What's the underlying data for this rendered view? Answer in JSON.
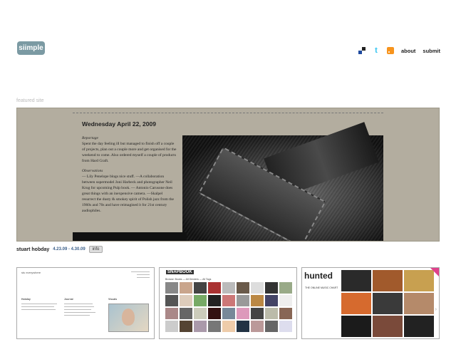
{
  "header": {
    "logo_text": "siimple",
    "nav": {
      "about": "about",
      "submit": "submit"
    },
    "icons": [
      "delicious-icon",
      "twitter-icon",
      "rss-icon"
    ]
  },
  "featured": {
    "label": "featured site",
    "post_date": "Wednesday April 22, 2009",
    "report_heading": "Reportage",
    "report_text": "Spent the day feeling ill but managed to finish off a couple of projects, plan out a couple more and get organised for the weekend to come. Also ordered myself a couple of products from Hard Graft.",
    "observations_heading": "Observations",
    "observations_text": "— Lily Penelope blogs nice stuff. —A collaboration between supermodel Joni Harbeck and photographer Neil Krug for upcoming Pulp book. — Antonio Carusone does great things with an inexpensive camera. —Skalpel resurrect the dusty & smokey spirit of Polish jazz from the 1960s and 70s and have reimagined it for 21st century audiophiles."
  },
  "credit": {
    "name": "stuart hobday",
    "dates": "4.23.09 - 4.30.09",
    "info_label": "info"
  },
  "thumbnails": [
    {
      "name": "thumb-stuart-hobday",
      "caption_left": "stu everywhere",
      "col1": "Hobday",
      "col2": "Journal",
      "col3": "Visuals"
    },
    {
      "name": "thumb-snapbook",
      "brand": "SNAPBOOK",
      "nav": "Browse: Books — All Genders — All Tags"
    },
    {
      "name": "thumb-hunted",
      "brand": "hunted",
      "sub": "THE ONLINE MUSIC CHART"
    }
  ],
  "colors": {
    "logo_bg": "#7b9aa3",
    "featured_bg": "#b3ad9f",
    "link_blue": "#3a5f8a",
    "rss_orange": "#f7941d",
    "twitter_blue": "#33c4f1",
    "hunted_pink": "#e0428b"
  }
}
